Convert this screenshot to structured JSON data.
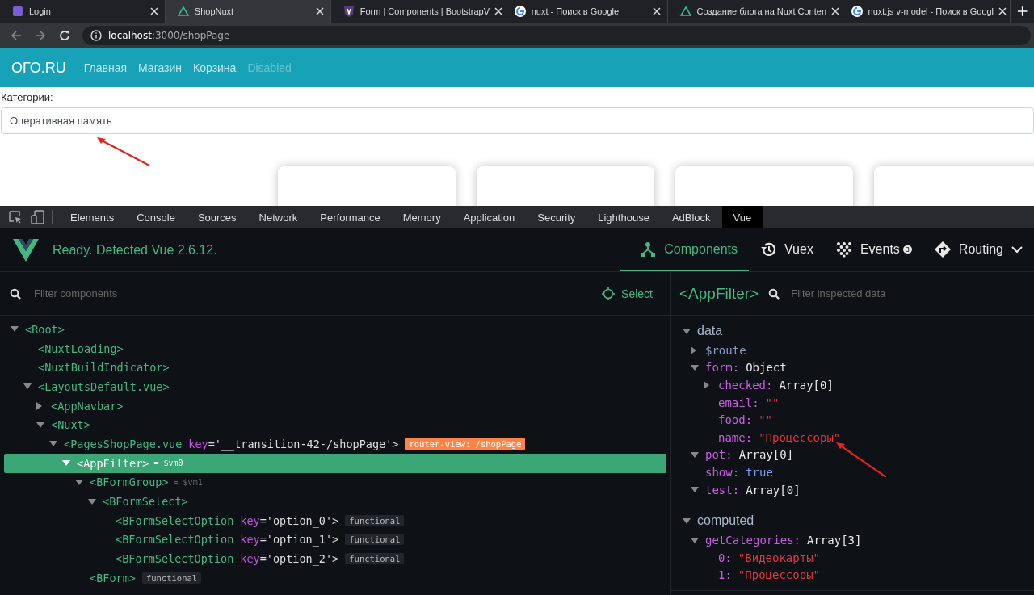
{
  "browser_tabs": [
    {
      "title": "Login",
      "kind": "square",
      "selected": false
    },
    {
      "title": "ShopNuxt",
      "kind": "nuxt",
      "selected": true
    },
    {
      "title": "Form | Components | BootstrapV",
      "kind": "shield",
      "selected": false
    },
    {
      "title": "nuxt - Поиск в Google",
      "kind": "google",
      "selected": false
    },
    {
      "title": "Создание блога на Nuxt Conten",
      "kind": "nuxt",
      "selected": false
    },
    {
      "title": "nuxt.js v-model - Поиск в Googl",
      "kind": "google",
      "selected": false
    }
  ],
  "address": {
    "host": "localhost",
    "path": ":3000/shopPage"
  },
  "navbar": {
    "brand": "ОГО.RU",
    "links": [
      {
        "label": "Главная",
        "disabled": false
      },
      {
        "label": "Магазин",
        "disabled": false
      },
      {
        "label": "Корзина",
        "disabled": false
      },
      {
        "label": "Disabled",
        "disabled": true
      }
    ]
  },
  "filter": {
    "label": "Категории:",
    "value": "Оперативная память"
  },
  "cards": [
    {
      "kind": "blank"
    },
    {
      "kind": "blank"
    },
    {
      "kind": "blank"
    },
    {
      "kind": "blank"
    }
  ],
  "devtools_tabs": [
    {
      "label": "Elements",
      "selected": false
    },
    {
      "label": "Console",
      "selected": false
    },
    {
      "label": "Sources",
      "selected": false
    },
    {
      "label": "Network",
      "selected": false
    },
    {
      "label": "Performance",
      "selected": false
    },
    {
      "label": "Memory",
      "selected": false
    },
    {
      "label": "Application",
      "selected": false
    },
    {
      "label": "Security",
      "selected": false
    },
    {
      "label": "Lighthouse",
      "selected": false
    },
    {
      "label": "AdBlock",
      "selected": false
    },
    {
      "label": "Vue",
      "selected": true
    }
  ],
  "vue_header": {
    "status": "Ready. Detected Vue 2.6.12.",
    "nav": [
      {
        "kind": "components",
        "label": "Components",
        "selected": true
      },
      {
        "kind": "vuex",
        "label": "Vuex",
        "selected": false
      },
      {
        "kind": "events",
        "label": "Events",
        "badge": "3",
        "selected": false
      },
      {
        "kind": "routing",
        "label": "Routing",
        "selected": false
      }
    ]
  },
  "components_panel": {
    "placeholder": "Filter components",
    "select_label": "Select",
    "tree": [
      {
        "tag": "<Root>",
        "expanded": true,
        "selected": false,
        "children": [
          {
            "tag": "<NuxtLoading>",
            "selected": false
          },
          {
            "tag": "<NuxtBuildIndicator>",
            "selected": false
          },
          {
            "tag": "<LayoutsDefault.vue>",
            "expanded": true,
            "selected": false,
            "children": [
              {
                "tag": "<AppNavbar>",
                "expanded": false,
                "selected": false
              },
              {
                "tag": "<Nuxt>",
                "expanded": true,
                "selected": false,
                "children": [
                  {
                    "tag": "<PagesShopPage.vue",
                    "attr_name": "key",
                    "attr_value": "='__transition-42-/shopPage'>",
                    "route_badge": "router-view: /shopPage",
                    "expanded": true,
                    "selected": false,
                    "children": [
                      {
                        "tag": "<AppFilter>",
                        "vm": "= $vm0",
                        "expanded": true,
                        "selected": true,
                        "children": [
                          {
                            "tag": "<BFormGroup>",
                            "vm": "= $vm1",
                            "expanded": true,
                            "selected": false,
                            "children": [
                              {
                                "tag": "<BFormSelect>",
                                "expanded": true,
                                "selected": false,
                                "children": [
                                  {
                                    "tag": "<BFormSelectOption",
                                    "attr_name": "key",
                                    "attr_value": "='option_0'>",
                                    "badge": "functional",
                                    "selected": false
                                  },
                                  {
                                    "tag": "<BFormSelectOption",
                                    "attr_name": "key",
                                    "attr_value": "='option_1'>",
                                    "badge": "functional",
                                    "selected": false
                                  },
                                  {
                                    "tag": "<BFormSelectOption",
                                    "attr_name": "key",
                                    "attr_value": "='option_2'>",
                                    "badge": "functional",
                                    "selected": false
                                  }
                                ]
                              }
                            ]
                          },
                          {
                            "tag": "<BForm>",
                            "badge": "functional",
                            "selected": false
                          }
                        ]
                      }
                    ]
                  }
                ]
              }
            ]
          }
        ]
      }
    ]
  },
  "inspector": {
    "title": "<AppFilter>",
    "placeholder": "Filter inspected data",
    "sections": [
      {
        "title": "data",
        "expanded": true,
        "items": [
          {
            "key": "$route",
            "kind": "meta",
            "expanded": false
          },
          {
            "key": "form:",
            "value": "Object",
            "kind": "type",
            "expanded": true,
            "children": [
              {
                "key": "checked:",
                "value": "Array[0]",
                "kind": "type",
                "expanded": false
              },
              {
                "key": "email:",
                "value": "\"\"",
                "kind": "string"
              },
              {
                "key": "food:",
                "value": "\"\"",
                "kind": "string"
              },
              {
                "key": "name:",
                "value": "\"Процессоры\"",
                "kind": "string"
              }
            ]
          },
          {
            "key": "pot:",
            "value": "Array[0]",
            "kind": "type",
            "expanded": true
          },
          {
            "key": "show:",
            "value": "true",
            "kind": "boolean"
          },
          {
            "key": "test:",
            "value": "Array[0]",
            "kind": "type",
            "expanded": true
          }
        ]
      },
      {
        "title": "computed",
        "expanded": true,
        "items": [
          {
            "key": "getCategories:",
            "value": "Array[3]",
            "kind": "type",
            "expanded": true,
            "children": [
              {
                "key": "0:",
                "value": "\"Видеокарты\"",
                "kind": "string"
              },
              {
                "key": "1:",
                "value": "\"Процессоры\"",
                "kind": "string"
              }
            ]
          }
        ]
      }
    ]
  },
  "annotations": [
    {
      "kind": "arrow"
    },
    {
      "kind": "arrow"
    }
  ]
}
